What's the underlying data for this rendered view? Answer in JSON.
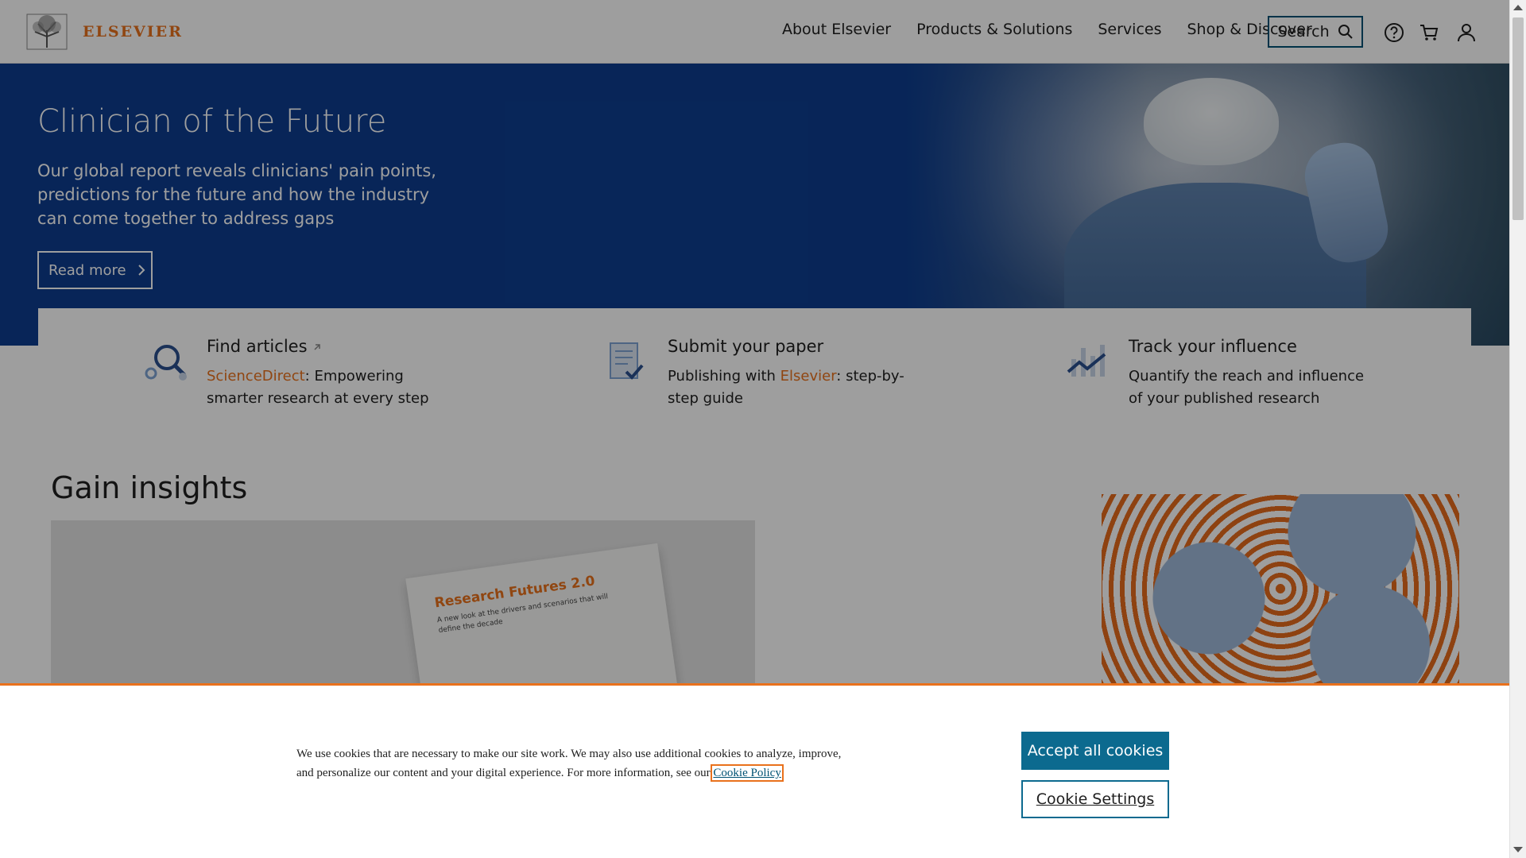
{
  "header": {
    "logo_text": "ELSEVIER",
    "nav": [
      "About Elsevier",
      "Products & Solutions",
      "Services",
      "Shop & Discover"
    ],
    "search_label": "Search",
    "icons": [
      "help-icon",
      "cart-icon",
      "user-icon"
    ]
  },
  "hero": {
    "title": "Clinician of the Future",
    "subtitle": "Our global report reveals clinicians' pain points, predictions for the future and how the industry can come together to address gaps",
    "cta": "Read more"
  },
  "features": [
    {
      "title": "Find articles",
      "desc_link": "ScienceDirect",
      "desc_rest": ": Empowering smarter research at every step",
      "icon": "magnifier-icon"
    },
    {
      "title": "Submit your paper",
      "desc_pre": "Publishing with ",
      "desc_link": "Elsevier",
      "desc_rest": ": step-by-step guide",
      "icon": "document-check-icon"
    },
    {
      "title": "Track your influence",
      "desc": "Quantify the reach and influence of your published research",
      "icon": "chart-icon"
    }
  ],
  "insights": {
    "title": "Gain insights",
    "book_title": "Research Futures 2.0",
    "book_sub": "A new look at the drivers and scenarios that will define the decade"
  },
  "cookie": {
    "text": "We use cookies that are necessary to make our site work. We may also use additional cookies to analyze, improve, and personalize our content and your digital experience. For more information, see our ",
    "link": "Cookie Policy",
    "accept": "Accept all cookies",
    "settings": "Cookie Settings"
  },
  "colors": {
    "brand_orange": "#e9711c",
    "hero_blue": "#0d3d8f",
    "accept_teal": "#0c6a8f"
  }
}
